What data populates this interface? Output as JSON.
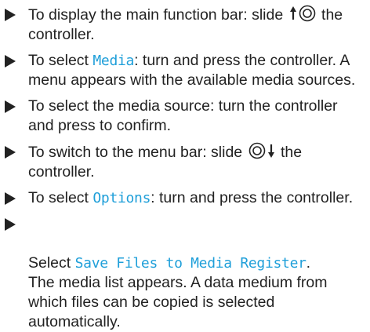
{
  "steps": [
    {
      "pre": "To display the main function bar: slide ",
      "symbol": "slide-up-controller",
      "post": " the controller."
    },
    {
      "pre": "To select ",
      "term": "Media",
      "post": ": turn and press the controller. A menu appears with the available media sources."
    },
    {
      "text": "To select the media source: turn the controller and press to confirm."
    },
    {
      "pre": "To switch to the menu bar: slide ",
      "symbol": "slide-down-controller",
      "post": " the controller."
    },
    {
      "pre": "To select ",
      "term": "Options",
      "post": ": turn and press the controller."
    },
    {
      "pre": "Select ",
      "term": "Save Files to Media Register",
      "post": ".\nThe media list appears. A data medium from which files can be copied is selected automatically."
    }
  ],
  "colors": {
    "text": "#222222",
    "highlight": "#1f9fd9"
  },
  "icons": {
    "bullet": "right-triangle-bullet",
    "controller_up": "slide-up-controller-icon",
    "controller_down": "slide-down-controller-icon"
  }
}
